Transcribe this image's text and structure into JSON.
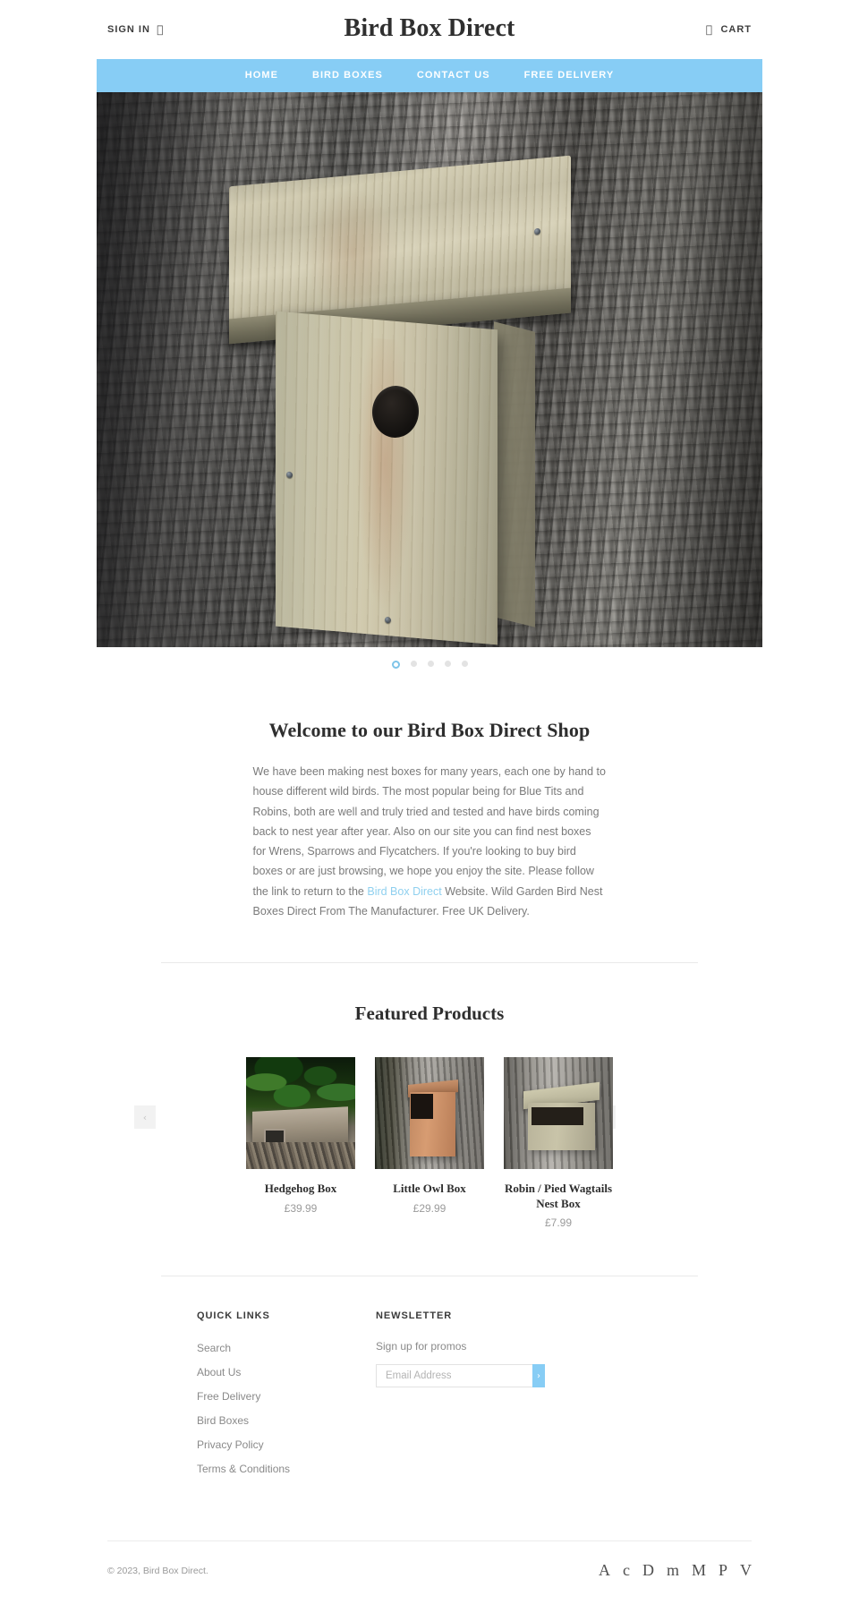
{
  "header": {
    "signin_label": "SIGN IN",
    "signin_icon": "user-icon",
    "site_title": "Bird Box Direct",
    "cart_label": "CART",
    "cart_icon": "shopping-bag-icon"
  },
  "nav": {
    "items": [
      {
        "label": "HOME"
      },
      {
        "label": "BIRD BOXES"
      },
      {
        "label": "CONTACT US"
      },
      {
        "label": "FREE DELIVERY"
      }
    ],
    "background_color": "#87cdf5"
  },
  "hero": {
    "alt": "Wooden bird nest box mounted on tree bark",
    "slide_count": 5,
    "active_slide": 1,
    "dot_active_color": "#7ec4e8",
    "dot_inactive_color": "#e3e3e3"
  },
  "welcome": {
    "heading": "Welcome to our Bird Box Direct Shop",
    "body_part1": "We have been making nest boxes for many years, each one by hand to house different wild birds. The most popular being for Blue Tits and Robins, both are well and truly tried and tested and have birds coming back to nest year after year. Also on our site you can find nest boxes for Wrens, Sparrows and Flycatchers. If you're looking to buy bird boxes or are just browsing, we hope you enjoy the site. Please follow the link to return to the ",
    "link_text": "Bird Box Direct",
    "body_part2": " Website. Wild Garden Bird Nest Boxes Direct From The Manufacturer. Free UK Delivery.",
    "link_color": "#8fd0ef"
  },
  "featured": {
    "heading": "Featured Products",
    "prev_icon": "chevron-left-icon",
    "next_icon": "chevron-right-icon",
    "prev_glyph": "‹",
    "next_glyph": "›",
    "products": [
      {
        "title": "Hedgehog Box",
        "price": "£39.99",
        "image": "hedgehog-box-image"
      },
      {
        "title": "Little Owl Box",
        "price": "£29.99",
        "image": "little-owl-box-image"
      },
      {
        "title": "Robin / Pied Wagtails Nest Box",
        "price": "£7.99",
        "image": "robin-pied-wagtails-nest-box-image"
      }
    ]
  },
  "footer": {
    "quick_links": {
      "heading": "QUICK LINKS",
      "items": [
        {
          "label": "Search"
        },
        {
          "label": "About Us"
        },
        {
          "label": "Free Delivery"
        },
        {
          "label": "Bird Boxes"
        },
        {
          "label": "Privacy Policy"
        },
        {
          "label": "Terms & Conditions"
        }
      ]
    },
    "newsletter": {
      "heading": "NEWSLETTER",
      "subtitle": "Sign up for promos",
      "placeholder": "Email Address",
      "value": "",
      "submit_glyph": "›",
      "submit_icon": "chevron-right-icon",
      "button_color": "#87cdf5"
    },
    "copyright": "© 2023, Bird Box Direct.",
    "payment_icons": [
      {
        "name": "amex-icon",
        "glyph": "A"
      },
      {
        "name": "apple-pay-icon",
        "glyph": "c"
      },
      {
        "name": "diners-club-icon",
        "glyph": "D"
      },
      {
        "name": "discover-icon",
        "glyph": "m"
      },
      {
        "name": "maestro-icon",
        "glyph": "M"
      },
      {
        "name": "paypal-icon",
        "glyph": "P"
      },
      {
        "name": "visa-icon",
        "glyph": "V"
      }
    ]
  }
}
